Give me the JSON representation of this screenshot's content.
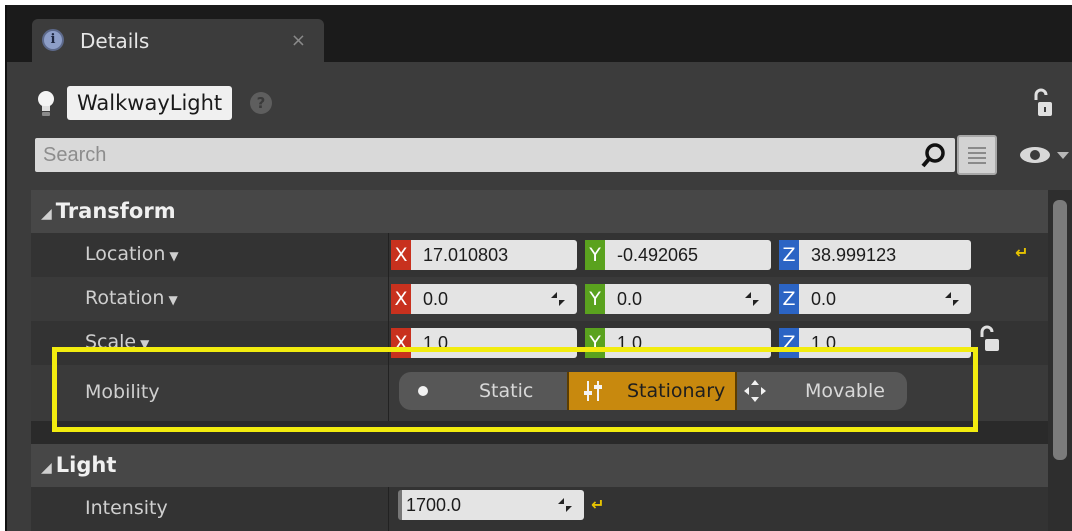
{
  "tab": {
    "title": "Details",
    "close": "×",
    "info": "i"
  },
  "actor": {
    "name": "WalkwayLight",
    "help": "?"
  },
  "search": {
    "placeholder": "Search",
    "value": ""
  },
  "transform": {
    "category": "Transform",
    "location": {
      "label": "Location",
      "x": "17.010803",
      "y": "-0.492065",
      "z": "38.999123"
    },
    "rotation": {
      "label": "Rotation",
      "x": "0.0",
      "y": "0.0",
      "z": "0.0"
    },
    "scale": {
      "label": "Scale",
      "x": "1.0",
      "y": "1.0",
      "z": "1.0"
    },
    "axis_labels": {
      "x": "X",
      "y": "Y",
      "z": "Z"
    },
    "mobility": {
      "label": "Mobility",
      "options": [
        "Static",
        "Stationary",
        "Movable"
      ],
      "selected": "Stationary"
    }
  },
  "light": {
    "category": "Light",
    "intensity": {
      "label": "Intensity",
      "value": "1700.0"
    }
  },
  "colors": {
    "accent": "#c8890e",
    "highlight": "#f2ec0f",
    "x": "#c8311e",
    "y": "#5aa21e",
    "z": "#2b64c4"
  },
  "icons": [
    "details-icon",
    "close-icon",
    "light-bulb-icon",
    "help-icon",
    "lock-icon",
    "search-icon",
    "view-options-icon",
    "eye-icon",
    "reset-arrow-icon",
    "spin-arrow-icon",
    "static-icon",
    "stationary-icon",
    "movable-icon"
  ]
}
